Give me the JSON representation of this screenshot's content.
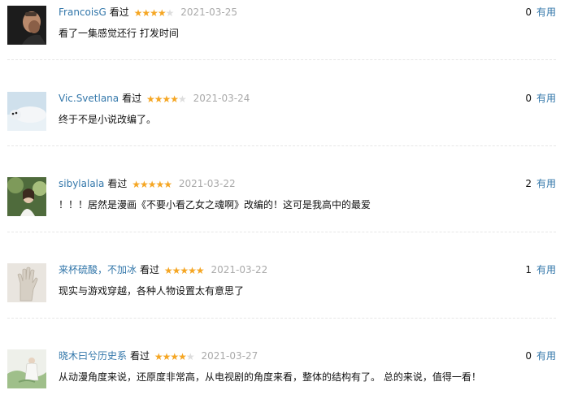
{
  "labels": {
    "watched": "看过",
    "useful": "有用"
  },
  "comments": [
    {
      "user": "FrancoisG",
      "rating": 4,
      "date": "2021-03-25",
      "votes": "0",
      "text": "看了一集感觉还行 打发时间",
      "avatar": "man-portrait-icon"
    },
    {
      "user": "Vic.Svetlana",
      "rating": 4,
      "date": "2021-03-24",
      "votes": "0",
      "text": "终于不是小说改编了。",
      "avatar": "seal-icon"
    },
    {
      "user": "sibylalala",
      "rating": 5,
      "date": "2021-03-22",
      "votes": "2",
      "text": "！！！居然是漫画《不要小看乙女之魂啊》改编的！这可是我高中的最爱",
      "avatar": "nature-girl-icon"
    },
    {
      "user": "来杯硫酸，不加冰",
      "rating": 5,
      "date": "2021-03-22",
      "votes": "1",
      "text": "现实与游戏穿越，各种人物设置太有意思了",
      "avatar": "hand-sculpture-icon"
    },
    {
      "user": "晓木曰兮历史系",
      "rating": 4,
      "date": "2021-03-27",
      "votes": "0",
      "text": "从动漫角度来说，还原度非常高，从电视剧的角度来看，整体的结构有了。 总的来说，值得一看！",
      "avatar": "painting-figure-icon"
    }
  ],
  "colors": {
    "link": "#3377aa",
    "star": "#f5a623",
    "star_empty": "#dddddd",
    "date": "#aaaaaa",
    "divider": "#e6e6e6"
  }
}
